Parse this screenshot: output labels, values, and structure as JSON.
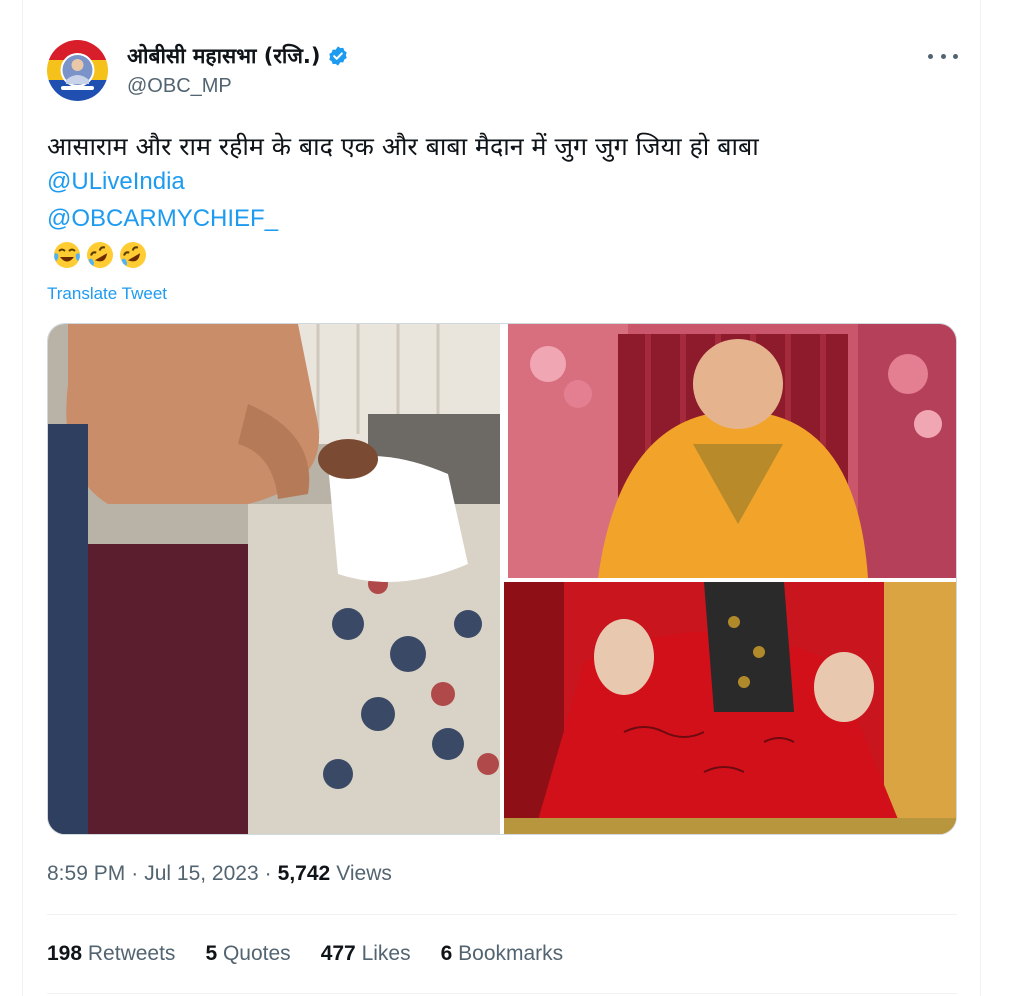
{
  "author": {
    "display_name": "ओबीसी महासभा (रजि.)",
    "handle": "@OBC_MP",
    "verified": true
  },
  "tweet": {
    "text": "आसाराम और राम रहीम के बाद एक और बाबा मैदान में जुग जुग जिया हो बाबा",
    "mentions": [
      "@ULiveIndia",
      "@OBCARMYCHIEF_"
    ],
    "emojis": [
      "face-with-tears-of-joy",
      "rolling-on-floor-laughing",
      "rolling-on-floor-laughing"
    ],
    "translate_label": "Translate Tweet"
  },
  "meta": {
    "time": "8:59 PM",
    "separator": "·",
    "date": "Jul 15, 2023",
    "views_count": "5,742",
    "views_label": "Views"
  },
  "stats": [
    {
      "count": "198",
      "label": "Retweets"
    },
    {
      "count": "5",
      "label": "Quotes"
    },
    {
      "count": "477",
      "label": "Likes"
    },
    {
      "count": "6",
      "label": "Bookmarks"
    }
  ],
  "colors": {
    "link": "#1d9bf0",
    "secondary_text": "#536471",
    "primary_text": "#0f1419"
  }
}
